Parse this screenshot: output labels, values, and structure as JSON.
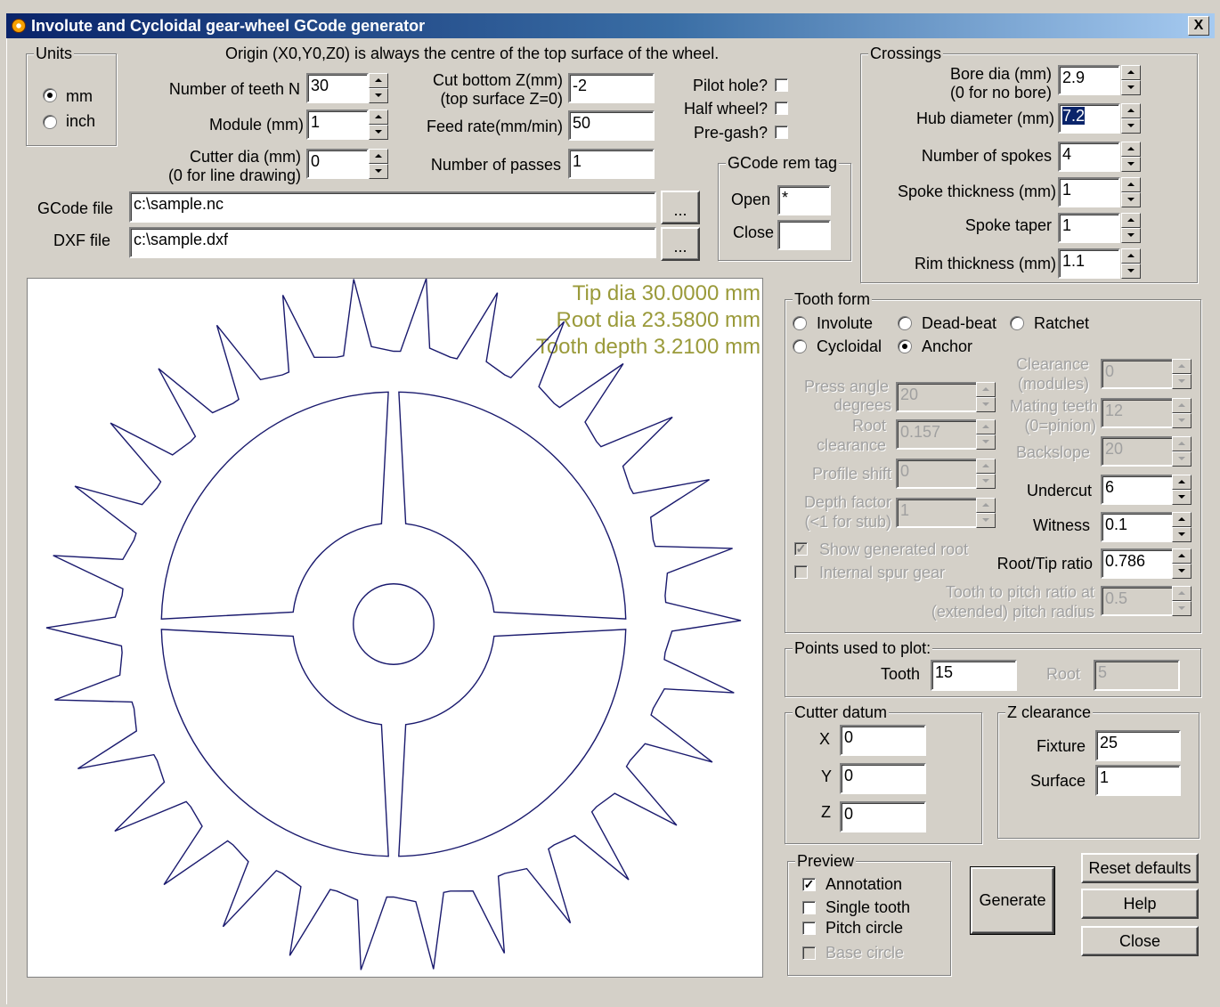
{
  "window": {
    "title": "Involute and Cycloidal gear-wheel GCode generator",
    "close_glyph": "X"
  },
  "origin_note": "Origin (X0,Y0,Z0) is always the centre of the top surface of the wheel.",
  "units": {
    "legend": "Units",
    "mm": "mm",
    "inch": "inch",
    "selected": "mm"
  },
  "params": {
    "teeth_label": "Number of teeth N",
    "teeth": "30",
    "module_label": "Module (mm)",
    "module": "1",
    "cutter_label_1": "Cutter dia (mm)",
    "cutter_label_2": "(0 for line drawing)",
    "cutter": "0",
    "cut_bottom_label_1": "Cut bottom Z(mm)",
    "cut_bottom_label_2": "(top surface Z=0)",
    "cut_bottom": "-2",
    "feed_label": "Feed rate(mm/min)",
    "feed": "50",
    "passes_label": "Number of passes",
    "passes": "1",
    "pilot_label": "Pilot hole?",
    "half_label": "Half wheel?",
    "pregash_label": "Pre-gash?"
  },
  "files": {
    "gcode_label": "GCode  file",
    "gcode": "c:\\sample.nc",
    "dxf_label": "DXF file",
    "dxf": "c:\\sample.dxf",
    "browse": "..."
  },
  "remtag": {
    "legend": "GCode rem tag",
    "open_label": "Open",
    "open": "*",
    "close_label": "Close",
    "close": ""
  },
  "crossings": {
    "legend": "Crossings",
    "bore_label_1": "Bore dia (mm)",
    "bore_label_2": "(0 for no bore)",
    "bore": "2.9",
    "hub_label": "Hub diameter (mm)",
    "hub": "7.2",
    "spokes_label": "Number of spokes",
    "spokes": "4",
    "spoke_thick_label": "Spoke thickness (mm)",
    "spoke_thick": "1",
    "spoke_taper_label": "Spoke taper",
    "spoke_taper": "1",
    "rim_label": "Rim thickness (mm)",
    "rim": "1.1"
  },
  "preview_annotation": {
    "tip": "Tip dia 30.0000 mm",
    "root": "Root dia 23.5800 mm",
    "depth": "Tooth depth  3.2100 mm"
  },
  "tooth_form": {
    "legend": "Tooth form",
    "involute": "Involute",
    "deadbeat": "Dead-beat",
    "ratchet": "Ratchet",
    "cycloidal": "Cycloidal",
    "anchor": "Anchor",
    "selected": "Anchor",
    "press_label_1": "Press angle",
    "press_label_2": "degrees",
    "press": "20",
    "rootclr_label_1": "Root",
    "rootclr_label_2": "clearance",
    "rootclr": "0.157",
    "shift_label": "Profile shift",
    "shift": "0",
    "depthf_label_1": "Depth factor",
    "depthf_label_2": "(<1 for stub)",
    "depthf": "1",
    "clearance_label_1": "Clearance",
    "clearance_label_2": "(modules)",
    "clearance": "0",
    "mating_label_1": "Mating teeth",
    "mating_label_2": "(0=pinion)",
    "mating": "12",
    "backslope_label": "Backslope",
    "backslope": "20",
    "undercut_label": "Undercut",
    "undercut": "6",
    "witness_label": "Witness",
    "witness": "0.1",
    "roottip_label": "Root/Tip ratio",
    "roottip": "0.786",
    "pitchratio_label_1": "Tooth to pitch ratio at",
    "pitchratio_label_2": "(extended) pitch radius",
    "pitchratio": "0.5",
    "show_root_label": "Show generated root",
    "internal_label": "Internal spur gear"
  },
  "points": {
    "legend": "Points used to plot:",
    "tooth_label": "Tooth",
    "tooth": "15",
    "root_label": "Root",
    "root": "5"
  },
  "cutter_datum": {
    "legend": "Cutter datum",
    "x_label": "X",
    "x": "0",
    "y_label": "Y",
    "y": "0",
    "z_label": "Z",
    "z": "0"
  },
  "zclear": {
    "legend": "Z clearance",
    "fixture_label": "Fixture",
    "fixture": "25",
    "surface_label": "Surface",
    "surface": "1"
  },
  "preview": {
    "legend": "Preview",
    "annotation": "Annotation",
    "single": "Single tooth",
    "pitch": "Pitch circle",
    "base": "Base circle"
  },
  "buttons": {
    "generate": "Generate",
    "reset": "Reset defaults",
    "help": "Help",
    "close": "Close"
  },
  "gear": {
    "teeth": 30,
    "spokes": 4,
    "tip_dia": 30.0,
    "root_dia": 23.58,
    "hub_dia": 7.2,
    "bore_dia": 2.9,
    "rim_thickness": 1.1,
    "spoke_thickness": 1,
    "stroke_color": "#1a1a6e"
  }
}
